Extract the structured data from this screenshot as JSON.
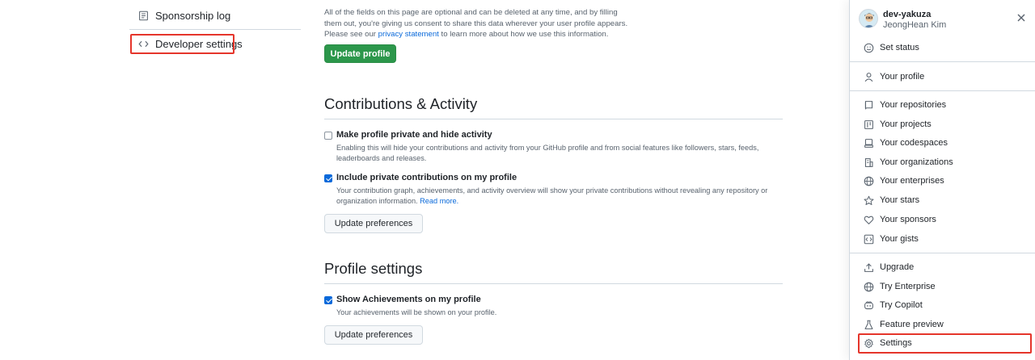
{
  "sidebar": {
    "items": [
      {
        "label": "Sponsorship log",
        "icon": "log-icon"
      },
      {
        "label": "Developer settings",
        "icon": "code-icon"
      }
    ]
  },
  "main": {
    "intro": {
      "text_before": "All of the fields on this page are optional and can be deleted at any time, and by filling them out, you're giving us consent to share this data wherever your user profile appears. Please see our ",
      "link": "privacy statement",
      "text_after": " to learn more about how we use this information."
    },
    "update_profile_label": "Update profile",
    "contributions": {
      "title": "Contributions & Activity",
      "options": [
        {
          "label": "Make profile private and hide activity",
          "description": "Enabling this will hide your contributions and activity from your GitHub profile and from social features like followers, stars, feeds, leaderboards and releases.",
          "checked": false
        },
        {
          "label": "Include private contributions on my profile",
          "description": "Your contribution graph, achievements, and activity overview will show your private contributions without revealing any repository or organization information. ",
          "link": "Read more.",
          "checked": true
        }
      ],
      "button_label": "Update preferences"
    },
    "profile_settings": {
      "title": "Profile settings",
      "options": [
        {
          "label": "Show Achievements on my profile",
          "description": "Your achievements will be shown on your profile.",
          "checked": true
        }
      ],
      "button_label": "Update preferences"
    }
  },
  "drawer": {
    "login": "dev-yakuza",
    "name": "JeongHean Kim",
    "close_icon": "close-icon",
    "items": [
      {
        "label": "Set status",
        "icon": "smiley-icon"
      },
      {
        "label": "Your profile",
        "icon": "person-icon"
      },
      {
        "label": "Your repositories",
        "icon": "repo-icon"
      },
      {
        "label": "Your projects",
        "icon": "project-icon"
      },
      {
        "label": "Your codespaces",
        "icon": "codespaces-icon"
      },
      {
        "label": "Your organizations",
        "icon": "organization-icon"
      },
      {
        "label": "Your enterprises",
        "icon": "globe-icon"
      },
      {
        "label": "Your stars",
        "icon": "star-icon"
      },
      {
        "label": "Your sponsors",
        "icon": "heart-icon"
      },
      {
        "label": "Your gists",
        "icon": "code-square-icon"
      },
      {
        "label": "Upgrade",
        "icon": "upload-icon"
      },
      {
        "label": "Try Enterprise",
        "icon": "globe-icon"
      },
      {
        "label": "Try Copilot",
        "icon": "copilot-icon"
      },
      {
        "label": "Feature preview",
        "icon": "beaker-icon"
      },
      {
        "label": "Settings",
        "icon": "gear-icon"
      }
    ]
  },
  "colors": {
    "accent": "#0969da",
    "primary_button": "#2c974b",
    "highlight_box": "#e5352b"
  }
}
